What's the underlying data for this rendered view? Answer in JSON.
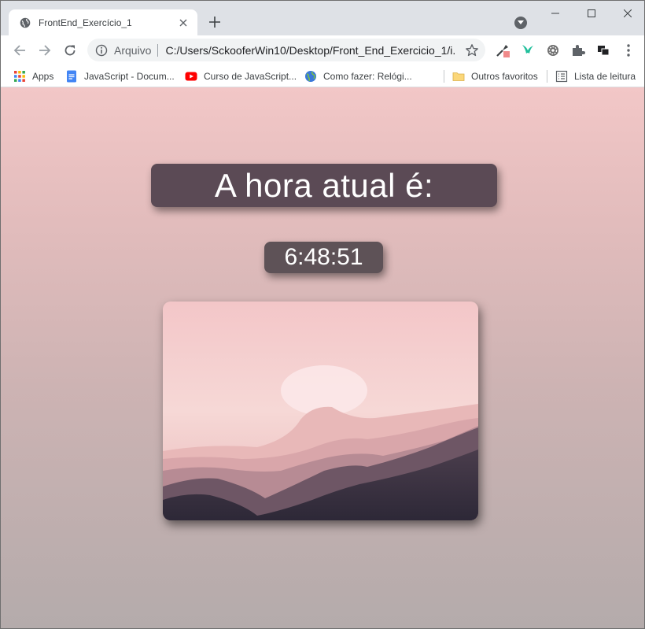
{
  "browser": {
    "tab": {
      "title": "FrontEnd_Exercício_1",
      "favicon": "globe-icon"
    },
    "address": {
      "scheme_label": "Arquivo",
      "url": "C:/Users/SckooferWin10/Desktop/Front_End_Exercicio_1/i..."
    },
    "bookmarks": [
      {
        "label": "Apps",
        "icon": "apps-grid-icon"
      },
      {
        "label": "JavaScript - Docum...",
        "icon": "google-docs-icon"
      },
      {
        "label": "Curso de JavaScript...",
        "icon": "youtube-icon"
      },
      {
        "label": "Como fazer: Relógi...",
        "icon": "web-globe-icon"
      },
      {
        "label": "Outros favoritos",
        "icon": "folder-icon"
      },
      {
        "label": "Lista de leitura",
        "icon": "reading-list-icon"
      }
    ]
  },
  "page": {
    "heading": "A hora atual é:",
    "clock": "6:48:51",
    "image": "sunset-mountains-image"
  },
  "colors": {
    "heading_bg": "#5b4a55",
    "clock_bg": "#5e5257",
    "page_top": "#f2c7c7",
    "page_bottom": "#b4abab"
  }
}
